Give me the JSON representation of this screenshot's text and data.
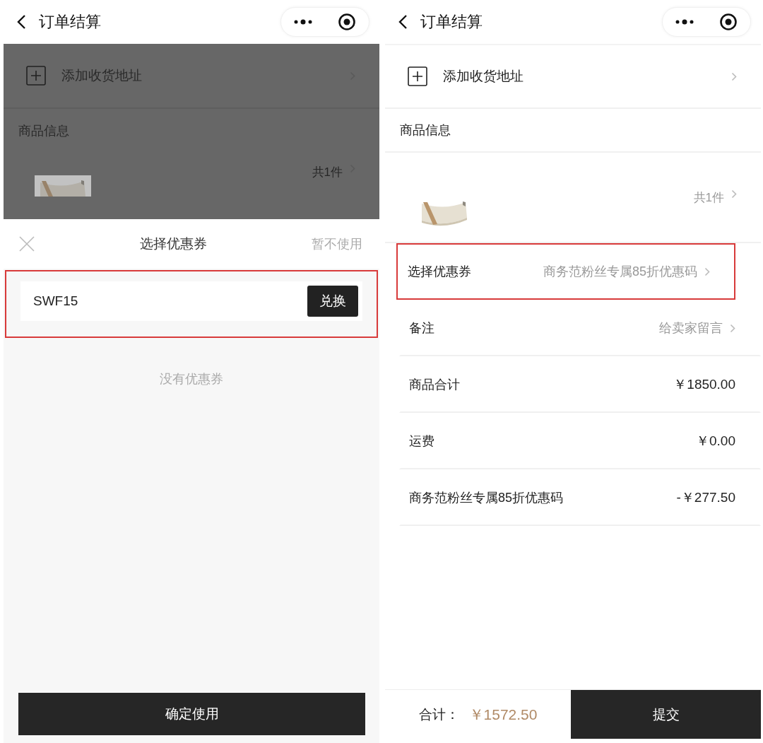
{
  "coupon_screen": {
    "header": {
      "title": "订单结算"
    },
    "behind": {
      "address": "添加收货地址",
      "section": "商品信息",
      "count": "共1件"
    },
    "sheet": {
      "title": "选择优惠券",
      "skip": "暂不使用",
      "code_value": "SWF15",
      "highlighted": true,
      "redeem": "兑换",
      "empty": "没有优惠券",
      "confirm": "确定使用"
    }
  },
  "checkout_screen": {
    "header": {
      "title": "订单结算"
    },
    "address": "添加收货地址",
    "section": "商品信息",
    "count": "共1件",
    "rows": [
      {
        "kind": "link",
        "label": "选择优惠券",
        "value": "商务范粉丝专属85折优惠码",
        "highlighted": true
      },
      {
        "kind": "link",
        "label": "备注",
        "value": "给卖家留言",
        "highlighted": false
      },
      {
        "kind": "amount",
        "label": "商品合计",
        "value": "￥1850.00",
        "highlighted": false
      },
      {
        "kind": "amount",
        "label": "运费",
        "value": "￥0.00",
        "highlighted": false
      },
      {
        "kind": "amount",
        "label": "商务范粉丝专属85折优惠码",
        "value": "-￥277.50",
        "highlighted": false
      }
    ],
    "footer": {
      "total_label": "合计：",
      "total": "￥1572.50",
      "submit": "提交"
    }
  }
}
